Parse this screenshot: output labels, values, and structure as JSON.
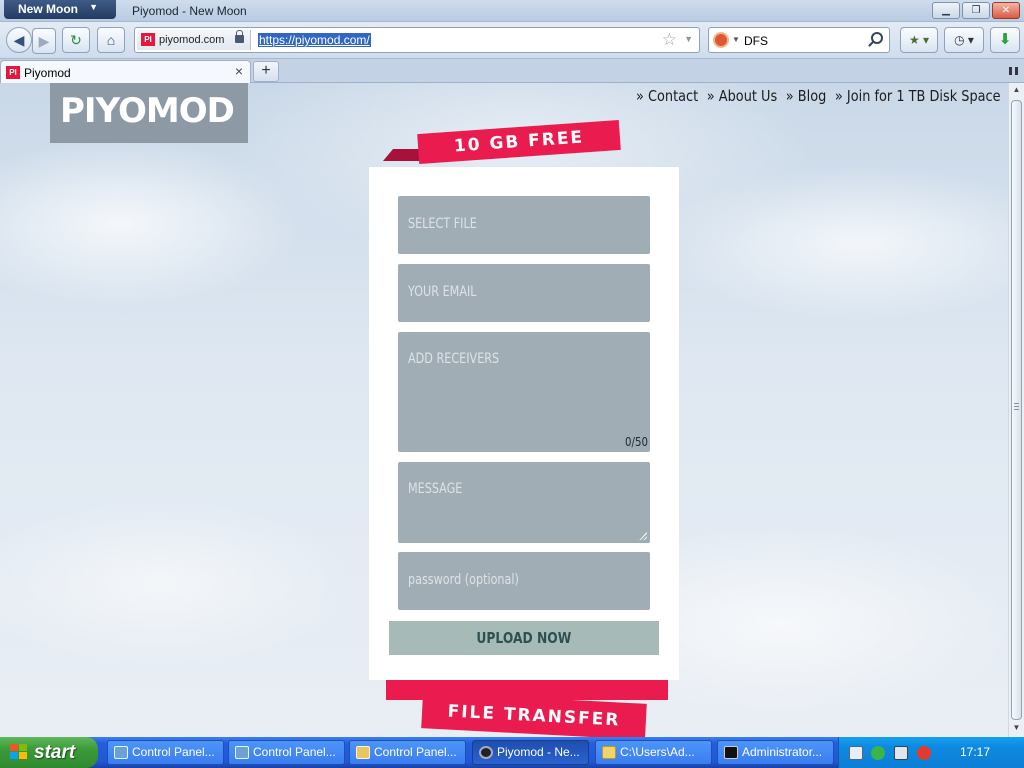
{
  "window": {
    "app_menu": "New Moon",
    "title": "Piyomod - New Moon"
  },
  "navbar": {
    "site_identity": "piyomod.com",
    "url": "https://piyomod.com/",
    "search_text": "DFS"
  },
  "tabs": [
    {
      "label": "Piyomod",
      "favicon_text": "PI"
    }
  ],
  "page": {
    "logo": "PIYOMOD",
    "nav_links": [
      "Contact",
      "About Us",
      "Blog",
      "Join for 1 TB Disk Space"
    ],
    "ribbon_top": "10 GB FREE",
    "ribbon_bottom": "FILE TRANSFER",
    "form": {
      "select_file": "SELECT FILE",
      "email_placeholder": "YOUR EMAIL",
      "receivers_placeholder": "ADD RECEIVERS",
      "receivers_counter": "0/50",
      "message_placeholder": "MESSAGE",
      "password_placeholder": "password (optional)",
      "upload_button": "UPLOAD NOW"
    },
    "accent_color": "#ea1c4f"
  },
  "taskbar": {
    "start_label": "start",
    "tasks": [
      {
        "label": "Control Panel...",
        "icon": "control-panel-icon",
        "active": false
      },
      {
        "label": "Control Panel...",
        "icon": "control-panel-icon",
        "active": false
      },
      {
        "label": "Control Panel...",
        "icon": "control-panel-icon",
        "active": false
      },
      {
        "label": "Piyomod - Ne...",
        "icon": "browser-icon",
        "active": true
      },
      {
        "label": "C:\\Users\\Ad...",
        "icon": "folder-icon",
        "active": false
      },
      {
        "label": "Administrator...",
        "icon": "cmd-icon",
        "active": false
      }
    ],
    "clock": "17:17"
  }
}
